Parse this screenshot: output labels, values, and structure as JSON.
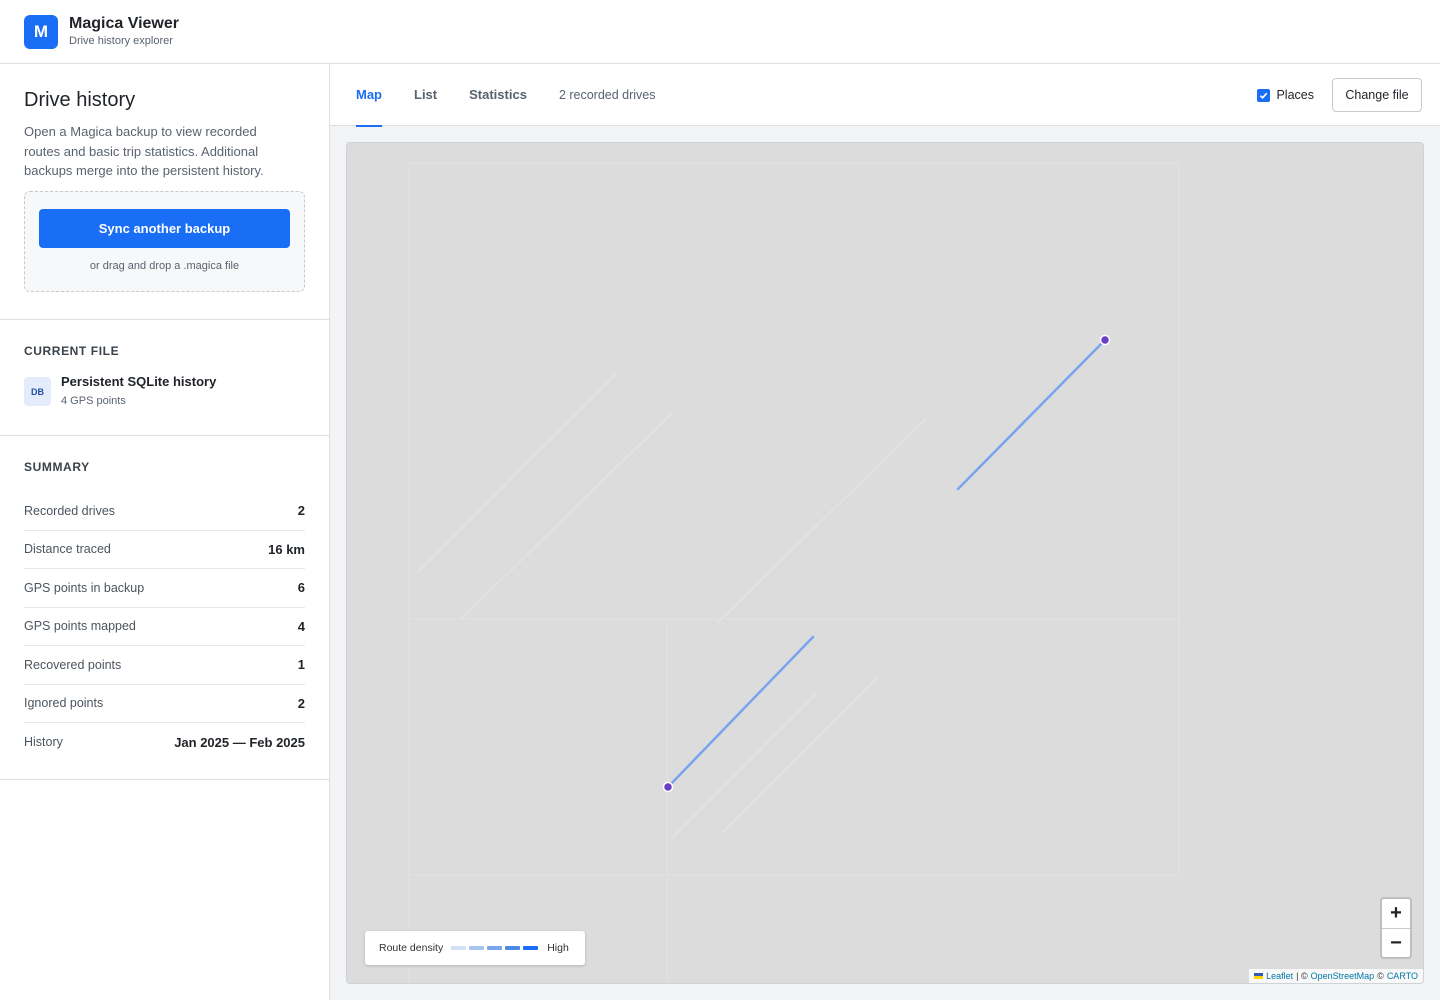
{
  "app": {
    "logo_letter": "M",
    "title": "Magica Viewer",
    "subtitle": "Drive history explorer"
  },
  "sidebar": {
    "heading": "Drive history",
    "description": "Open a Magica backup to view recorded routes and basic trip statistics. Additional backups merge into the persistent history.",
    "sync_button": "Sync another backup",
    "drop_hint": "or drag and drop a .magica file",
    "current_file": {
      "section_title": "CURRENT FILE",
      "badge": "DB",
      "name": "Persistent SQLite history",
      "meta": "4 GPS points"
    },
    "summary": {
      "section_title": "SUMMARY",
      "rows": [
        {
          "label": "Recorded drives",
          "value": "2"
        },
        {
          "label": "Distance traced",
          "value": "16 km"
        },
        {
          "label": "GPS points in backup",
          "value": "6"
        },
        {
          "label": "GPS points mapped",
          "value": "4"
        },
        {
          "label": "Recovered points",
          "value": "1"
        },
        {
          "label": "Ignored points",
          "value": "2"
        },
        {
          "label": "History",
          "value": "Jan 2025 — Feb 2025"
        }
      ]
    }
  },
  "tabs": {
    "items": [
      "Map",
      "List",
      "Statistics"
    ],
    "active": "Map",
    "drive_count": "2 recorded drives"
  },
  "toolbar": {
    "places_label": "Places",
    "places_checked": true,
    "change_file": "Change file"
  },
  "map": {
    "legend_label": "Route density",
    "legend_high": "High",
    "legend_colors": [
      "#cfe0f7",
      "#a6c6ef",
      "#78a8e6",
      "#4a8ae0",
      "#1a6ef5"
    ],
    "route_color": "#7aa3ee",
    "marker_color": "#6a3fc8",
    "zoom_in": "+",
    "zoom_out": "−",
    "attribution": {
      "leaflet": "Leaflet",
      "sep1": "| ©",
      "osm": "OpenStreetMap",
      "sep2": "©",
      "carto": "CARTO"
    }
  }
}
